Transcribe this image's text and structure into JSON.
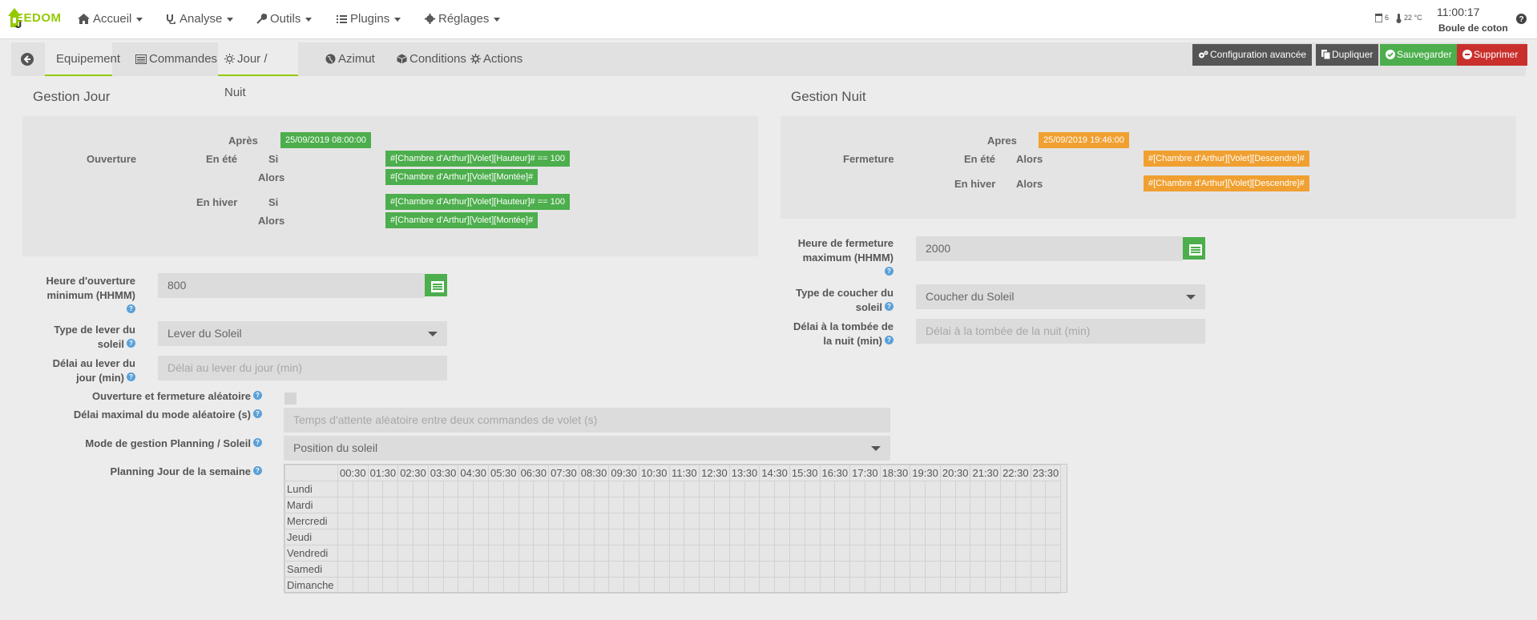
{
  "navbar": {
    "logo_text": "EEDOM",
    "menu": [
      {
        "label": "Accueil",
        "icon": "home-icon"
      },
      {
        "label": "Analyse",
        "icon": "stethoscope-icon"
      },
      {
        "label": "Outils",
        "icon": "wrench-icon"
      },
      {
        "label": "Plugins",
        "icon": "list-icon"
      },
      {
        "label": "Réglages",
        "icon": "cog-icon"
      }
    ],
    "status_door": "6",
    "status_temp": "22 °C",
    "clock": "11:00:17",
    "user": "Boule de coton"
  },
  "tabs": [
    {
      "label": "Equipement"
    },
    {
      "label": "Commandes"
    },
    {
      "label": "Jour / Nuit"
    },
    {
      "label": "Azimut"
    },
    {
      "label": "Conditions"
    },
    {
      "label": "Actions"
    }
  ],
  "actions": {
    "config": "Configuration avancée",
    "duplicate": "Dupliquer",
    "save": "Sauvegarder",
    "delete": "Supprimer"
  },
  "colors": {
    "accent": "#94ca02",
    "green": "#4cae4c",
    "orange": "#f0a030",
    "danger": "#c9302c",
    "dark_btn": "#555555"
  },
  "jour": {
    "title": "Gestion Jour",
    "ouverture_label": "Ouverture",
    "apres_label": "Après",
    "apres_value": "25/09/2019 08:00:00",
    "ete_label": "En été",
    "hiver_label": "En hiver",
    "si_label": "Si",
    "alors_label": "Alors",
    "ete_si": "#[Chambre d'Arthur][Volet][Hauteur]# == 100",
    "ete_alors": "#[Chambre d'Arthur][Volet][Montée]#",
    "hiver_si": "#[Chambre d'Arthur][Volet][Hauteur]# == 100",
    "hiver_alors": "#[Chambre d'Arthur][Volet][Montée]#",
    "heure_label_1": "Heure d'ouverture",
    "heure_label_2": "minimum (HHMM)",
    "heure_value": "800",
    "type_label_1": "Type de lever du",
    "type_label_2": "soleil",
    "type_value": "Lever du Soleil",
    "delai_label_1": "Délai au lever du",
    "delai_label_2": "jour (min)",
    "delai_placeholder": "Délai au lever du jour (min)"
  },
  "nuit": {
    "title": "Gestion Nuit",
    "fermeture_label": "Fermeture",
    "apres_label": "Apres",
    "apres_value": "25/09/2019 19:46:00",
    "ete_label": "En été",
    "hiver_label": "En hiver",
    "alors_label": "Alors",
    "ete_alors": "#[Chambre d'Arthur][Volet][Descendre]#",
    "hiver_alors": "#[Chambre d'Arthur][Volet][Descendre]#",
    "heure_label_1": "Heure de fermeture",
    "heure_label_2": "maximum (HHMM)",
    "heure_value": "2000",
    "type_label_1": "Type de coucher du",
    "type_label_2": "soleil",
    "type_value": "Coucher du Soleil",
    "delai_label_1": "Délai à la tombée de",
    "delai_label_2": "la nuit (min)",
    "delai_placeholder": "Délai à la tombée de la nuit (min)"
  },
  "aleatoire": {
    "label": "Ouverture et fermeture aléatoire",
    "delai_label": "Délai maximal du mode aléatoire (s)",
    "delai_placeholder": "Temps d'attente aléatoire entre deux commandes de volet (s)"
  },
  "mode": {
    "label": "Mode de gestion Planning / Soleil",
    "value": "Position du soleil"
  },
  "planning": {
    "label": "Planning Jour de la semaine",
    "hours": [
      "00:30",
      "01:30",
      "02:30",
      "03:30",
      "04:30",
      "05:30",
      "06:30",
      "07:30",
      "08:30",
      "09:30",
      "10:30",
      "11:30",
      "12:30",
      "13:30",
      "14:30",
      "15:30",
      "16:30",
      "17:30",
      "18:30",
      "19:30",
      "20:30",
      "21:30",
      "22:30",
      "23:30"
    ],
    "days": [
      "Lundi",
      "Mardi",
      "Mercredi",
      "Jeudi",
      "Vendredi",
      "Samedi",
      "Dimanche"
    ]
  }
}
